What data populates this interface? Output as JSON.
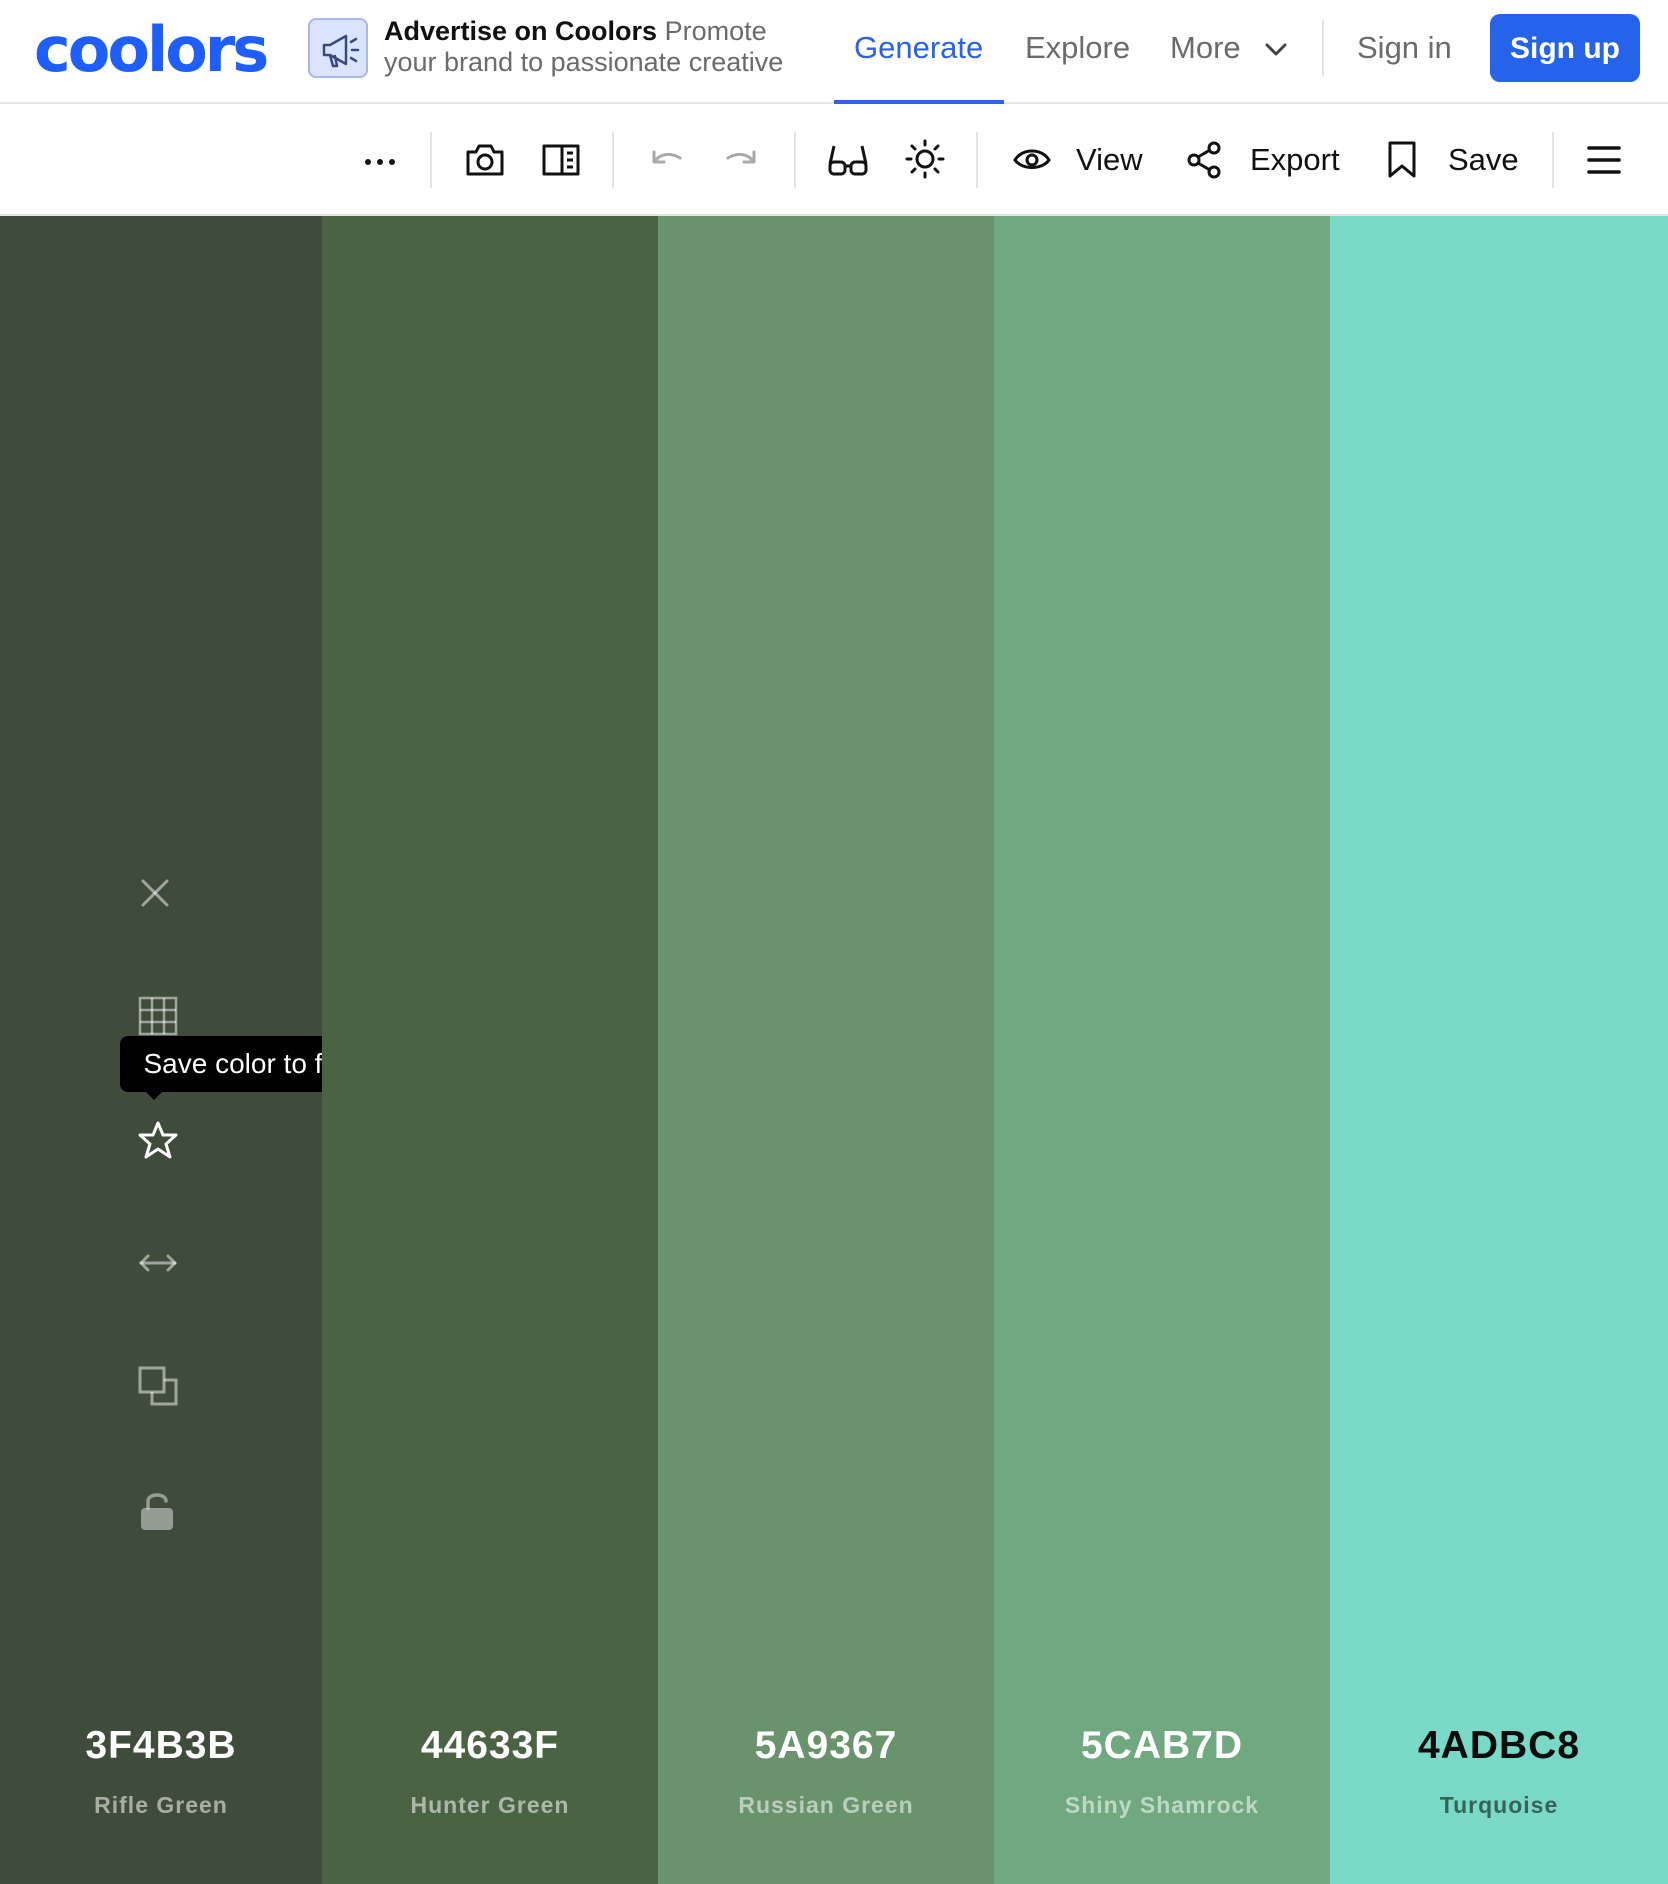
{
  "nav": {
    "logo": "coolors",
    "ad_title": "Advertise on Coolors",
    "ad_text": "Promote your brand to passionate creative",
    "generate": "Generate",
    "explore": "Explore",
    "more": "More",
    "signin": "Sign in",
    "signup": "Sign up",
    "accent": "#2563eb"
  },
  "toolbar": {
    "view_label": "View",
    "export_label": "Export",
    "save_label": "Save",
    "icons": [
      "more-dots-icon",
      "camera-icon",
      "layout-icon",
      "undo-icon",
      "redo-icon",
      "glasses-icon",
      "brightness-icon",
      "eye-icon",
      "share-icon",
      "bookmark-icon",
      "menu-icon"
    ]
  },
  "palette": {
    "swatches": [
      {
        "hex": "3F4B3B",
        "name": "Rifle Green",
        "color": "#3F4B3B"
      },
      {
        "hex": "44633F",
        "name": "Hunter Green",
        "color": "#4A6343"
      },
      {
        "hex": "5A9367",
        "name": "Russian Green",
        "color": "#68936B"
      },
      {
        "hex": "5CAB7D",
        "name": "Shiny Shamrock",
        "color": "#70A97F"
      },
      {
        "hex": "4ADBC8",
        "name": "Turquoise",
        "color": "#78D9C7"
      }
    ],
    "tooltip": "Save color to favorites",
    "swatch_tools": [
      "close-icon",
      "shades-grid-icon",
      "star-icon",
      "drag-arrows-icon",
      "copy-icon",
      "unlock-icon"
    ]
  }
}
